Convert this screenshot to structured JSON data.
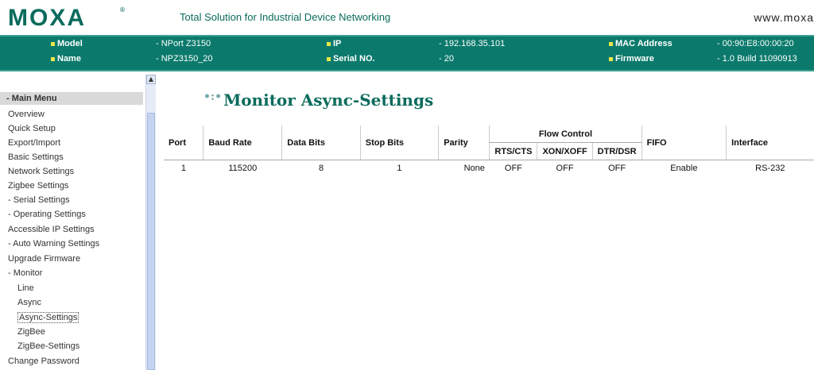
{
  "header": {
    "logo": "MOXA",
    "logo_reg": "®",
    "tagline": "Total Solution for Industrial Device Networking",
    "website": "www.moxa"
  },
  "infobar": {
    "model_label": "Model",
    "model_value": "- NPort Z3150",
    "name_label": "Name",
    "name_value": "- NPZ3150_20",
    "ip_label": "IP",
    "ip_value": "- 192.168.35.101",
    "serial_label": "Serial NO.",
    "serial_value": "- 20",
    "mac_label": "MAC Address",
    "mac_value": "- 00:90:E8:00:00:20",
    "firmware_label": "Firmware",
    "firmware_value": "- 1.0 Build 11090913"
  },
  "sidebar": {
    "heading": "- Main Menu",
    "items": [
      "Overview",
      "Quick Setup",
      "Export/Import",
      "Basic Settings",
      "Network Settings",
      "Zigbee Settings",
      "- Serial Settings",
      "- Operating Settings",
      "Accessible IP Settings",
      "- Auto Warning Settings",
      "Upgrade Firmware",
      "- Monitor",
      "Line",
      "Async",
      "Async-Settings",
      "ZigBee",
      "ZigBee-Settings",
      "Change Password"
    ],
    "selected": "Async-Settings"
  },
  "main": {
    "title": "Monitor Async-Settings",
    "columns": {
      "port": "Port",
      "baud": "Baud Rate",
      "data_bits": "Data Bits",
      "stop_bits": "Stop Bits",
      "parity": "Parity",
      "flow_control": "Flow Control",
      "rts_cts": "RTS/CTS",
      "xon_xoff": "XON/XOFF",
      "dtr_dsr": "DTR/DSR",
      "fifo": "FIFO",
      "interface": "Interface"
    },
    "rows": [
      {
        "port": "1",
        "baud": "115200",
        "data_bits": "8",
        "stop_bits": "1",
        "parity": "None",
        "rts_cts": "OFF",
        "xon_xoff": "OFF",
        "dtr_dsr": "OFF",
        "fifo": "Enable",
        "interface": "RS-232"
      }
    ]
  },
  "colors": {
    "brand": "#0a6b5c",
    "infobar": "#0b7a6c",
    "bullet": "#e8e84a"
  }
}
